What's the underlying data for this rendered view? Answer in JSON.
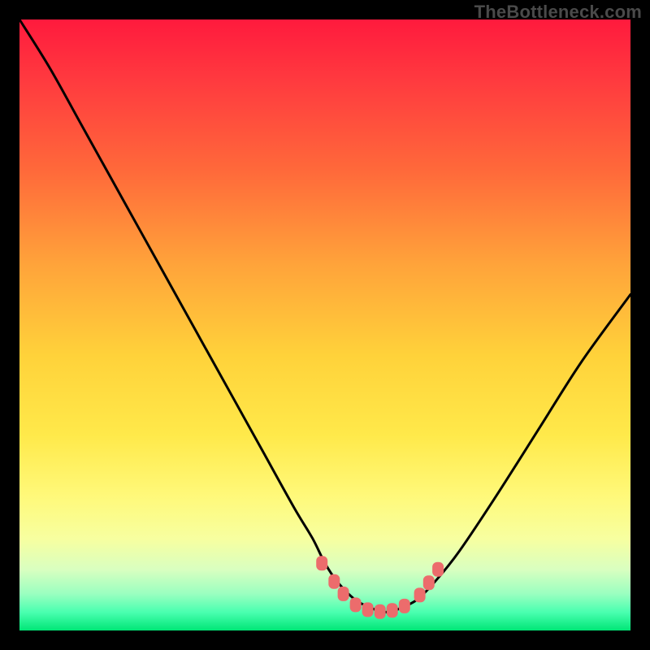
{
  "branding": "TheBottleneck.com",
  "colors": {
    "frame": "#000000",
    "gradient_top": "#ff1a3d",
    "gradient_mid": "#ffd23a",
    "gradient_bottom": "#00e676",
    "curve": "#000000",
    "marker": "#ec6c6c"
  },
  "chart_data": {
    "type": "line",
    "title": "",
    "xlabel": "",
    "ylabel": "",
    "xlim": [
      0,
      100
    ],
    "ylim": [
      0,
      100
    ],
    "grid": false,
    "legend": false,
    "note": "Axes have no printed tick labels; x/y are normalized 0–100 across the visible plot area. y maps linearly from green (0) at the bottom to red (100) at the top. A single black V-shaped curve descends from top-left, flattens near y≈3 around x≈55–63, then rises toward the right edge reaching y≈55. Salmon markers cluster near the trough.",
    "series": [
      {
        "name": "curve",
        "x": [
          0,
          5,
          10,
          15,
          20,
          25,
          30,
          35,
          40,
          45,
          48,
          50,
          52,
          55,
          58,
          60,
          62,
          65,
          68,
          72,
          78,
          85,
          92,
          100
        ],
        "y": [
          100,
          92,
          83,
          74,
          65,
          56,
          47,
          38,
          29,
          20,
          15,
          11,
          8,
          5,
          3.5,
          3,
          3.5,
          5,
          8,
          13,
          22,
          33,
          44,
          55
        ]
      }
    ],
    "markers": [
      {
        "x": 49.5,
        "y": 11
      },
      {
        "x": 51.5,
        "y": 8
      },
      {
        "x": 53,
        "y": 6
      },
      {
        "x": 55,
        "y": 4.2
      },
      {
        "x": 57,
        "y": 3.4
      },
      {
        "x": 59,
        "y": 3.1
      },
      {
        "x": 61,
        "y": 3.3
      },
      {
        "x": 63,
        "y": 4.0
      },
      {
        "x": 65.5,
        "y": 5.8
      },
      {
        "x": 67,
        "y": 7.8
      },
      {
        "x": 68.5,
        "y": 10
      }
    ]
  }
}
